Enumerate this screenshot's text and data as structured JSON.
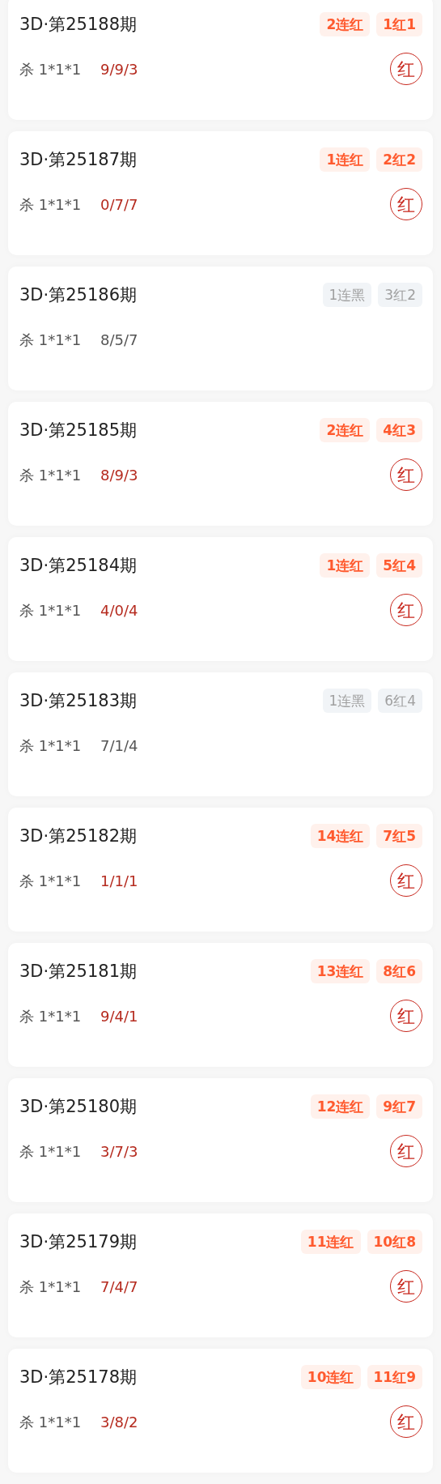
{
  "cards": [
    {
      "title": "3D·第25188期",
      "streak": "2连红",
      "record": "1红1",
      "hit": true,
      "kill": "杀 1*1*1",
      "numbers": "9/9/3",
      "result": "红"
    },
    {
      "title": "3D·第25187期",
      "streak": "1连红",
      "record": "2红2",
      "hit": true,
      "kill": "杀 1*1*1",
      "numbers": "0/7/7",
      "result": "红"
    },
    {
      "title": "3D·第25186期",
      "streak": "1连黑",
      "record": "3红2",
      "hit": false,
      "kill": "杀 1*1*1",
      "numbers": "8/5/7"
    },
    {
      "title": "3D·第25185期",
      "streak": "2连红",
      "record": "4红3",
      "hit": true,
      "kill": "杀 1*1*1",
      "numbers": "8/9/3",
      "result": "红"
    },
    {
      "title": "3D·第25184期",
      "streak": "1连红",
      "record": "5红4",
      "hit": true,
      "kill": "杀 1*1*1",
      "numbers": "4/0/4",
      "result": "红"
    },
    {
      "title": "3D·第25183期",
      "streak": "1连黑",
      "record": "6红4",
      "hit": false,
      "kill": "杀 1*1*1",
      "numbers": "7/1/4"
    },
    {
      "title": "3D·第25182期",
      "streak": "14连红",
      "record": "7红5",
      "hit": true,
      "kill": "杀 1*1*1",
      "numbers": "1/1/1",
      "result": "红"
    },
    {
      "title": "3D·第25181期",
      "streak": "13连红",
      "record": "8红6",
      "hit": true,
      "kill": "杀 1*1*1",
      "numbers": "9/4/1",
      "result": "红"
    },
    {
      "title": "3D·第25180期",
      "streak": "12连红",
      "record": "9红7",
      "hit": true,
      "kill": "杀 1*1*1",
      "numbers": "3/7/3",
      "result": "红"
    },
    {
      "title": "3D·第25179期",
      "streak": "11连红",
      "record": "10红8",
      "hit": true,
      "kill": "杀 1*1*1",
      "numbers": "7/4/7",
      "result": "红"
    },
    {
      "title": "3D·第25178期",
      "streak": "10连红",
      "record": "11红9",
      "hit": true,
      "kill": "杀 1*1*1",
      "numbers": "3/8/2",
      "result": "红"
    }
  ]
}
